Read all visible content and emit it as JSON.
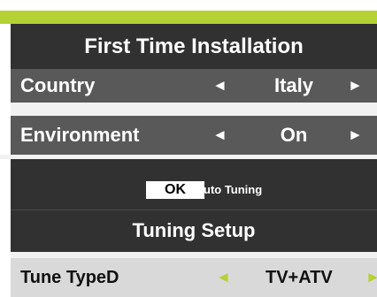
{
  "header": {
    "title": "First Time Installation"
  },
  "settings": [
    {
      "label": "Country",
      "value": "Italy",
      "left_arrow": "◄",
      "right_arrow": "►"
    },
    {
      "label": "Environment",
      "value": "On",
      "left_arrow": "◄",
      "right_arrow": "►"
    }
  ],
  "auto_tuning": {
    "ok_label": "OK",
    "text": "uto Tuning"
  },
  "tuning_setup": {
    "title": "Tuning Setup",
    "row": {
      "label": "Tune TypeD",
      "value": "TV+ATV",
      "left_arrow": "◄",
      "right_arrow": "►"
    }
  },
  "colors": {
    "accent": "#b5d133",
    "dark": "#313131",
    "row": "#595959",
    "highlight_row": "#d9d9d9"
  }
}
